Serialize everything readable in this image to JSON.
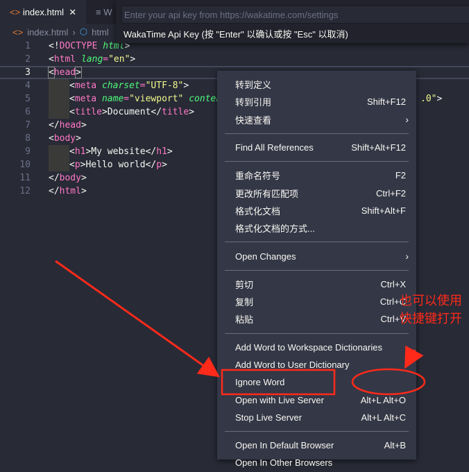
{
  "tabs": [
    {
      "label": "index.html",
      "icon": "html-icon",
      "close": "✕"
    },
    {
      "label": "W",
      "icon": "preview-icon"
    }
  ],
  "breadcrumb": {
    "file": "index.html",
    "symbol": "html"
  },
  "quick_input": {
    "placeholder": "Enter your api key from https://wakatime.com/settings",
    "hint": "WakaTime Api Key (按 \"Enter\" 以确认或按 \"Esc\" 以取消)"
  },
  "code_lines": [
    "1",
    "2",
    "3",
    "4",
    "5",
    "6",
    "7",
    "8",
    "9",
    "10",
    "11",
    "12"
  ],
  "code": {
    "doctype": "DOCTYPE",
    "html_kw": "html",
    "lang_attr": "lang",
    "en": "\"en\"",
    "head": "head",
    "meta": "meta",
    "charset": "charset",
    "utf8": "\"UTF-8\"",
    "name": "name",
    "viewport": "\"viewport\"",
    "content": "conten",
    "tail": ".0\"",
    "title": "title",
    "document": "Document",
    "body": "body",
    "h1": "h1",
    "mywebsite": "My website",
    "p": "p",
    "hello": "Hello world"
  },
  "menu": [
    {
      "label": "转到定义",
      "shortcut": ""
    },
    {
      "label": "转到引用",
      "shortcut": "Shift+F12"
    },
    {
      "label": "快速查看",
      "shortcut": "",
      "submenu": true
    },
    {
      "sep": true
    },
    {
      "label": "Find All References",
      "shortcut": "Shift+Alt+F12"
    },
    {
      "sep": true
    },
    {
      "label": "重命名符号",
      "shortcut": "F2"
    },
    {
      "label": "更改所有匹配项",
      "shortcut": "Ctrl+F2"
    },
    {
      "label": "格式化文档",
      "shortcut": "Shift+Alt+F"
    },
    {
      "label": "格式化文档的方式...",
      "shortcut": ""
    },
    {
      "sep": true
    },
    {
      "label": "Open Changes",
      "shortcut": "",
      "submenu": true
    },
    {
      "sep": true
    },
    {
      "label": "剪切",
      "shortcut": "Ctrl+X"
    },
    {
      "label": "复制",
      "shortcut": "Ctrl+C"
    },
    {
      "label": "粘贴",
      "shortcut": "Ctrl+V"
    },
    {
      "sep": true
    },
    {
      "label": "Add Word to Workspace Dictionaries",
      "shortcut": ""
    },
    {
      "label": "Add Word to User Dictionary",
      "shortcut": ""
    },
    {
      "label": "Ignore Word",
      "shortcut": ""
    },
    {
      "label": "Open with Live Server",
      "shortcut": "Alt+L Alt+O"
    },
    {
      "label": "Stop Live Server",
      "shortcut": "Alt+L Alt+C"
    },
    {
      "sep": true
    },
    {
      "label": "Open In Default Browser",
      "shortcut": "Alt+B"
    },
    {
      "label": "Open In Other Browsers",
      "shortcut": ""
    }
  ],
  "annotation": {
    "note": "也可以使用快捷键打开",
    "color": "#ff2a1a"
  }
}
